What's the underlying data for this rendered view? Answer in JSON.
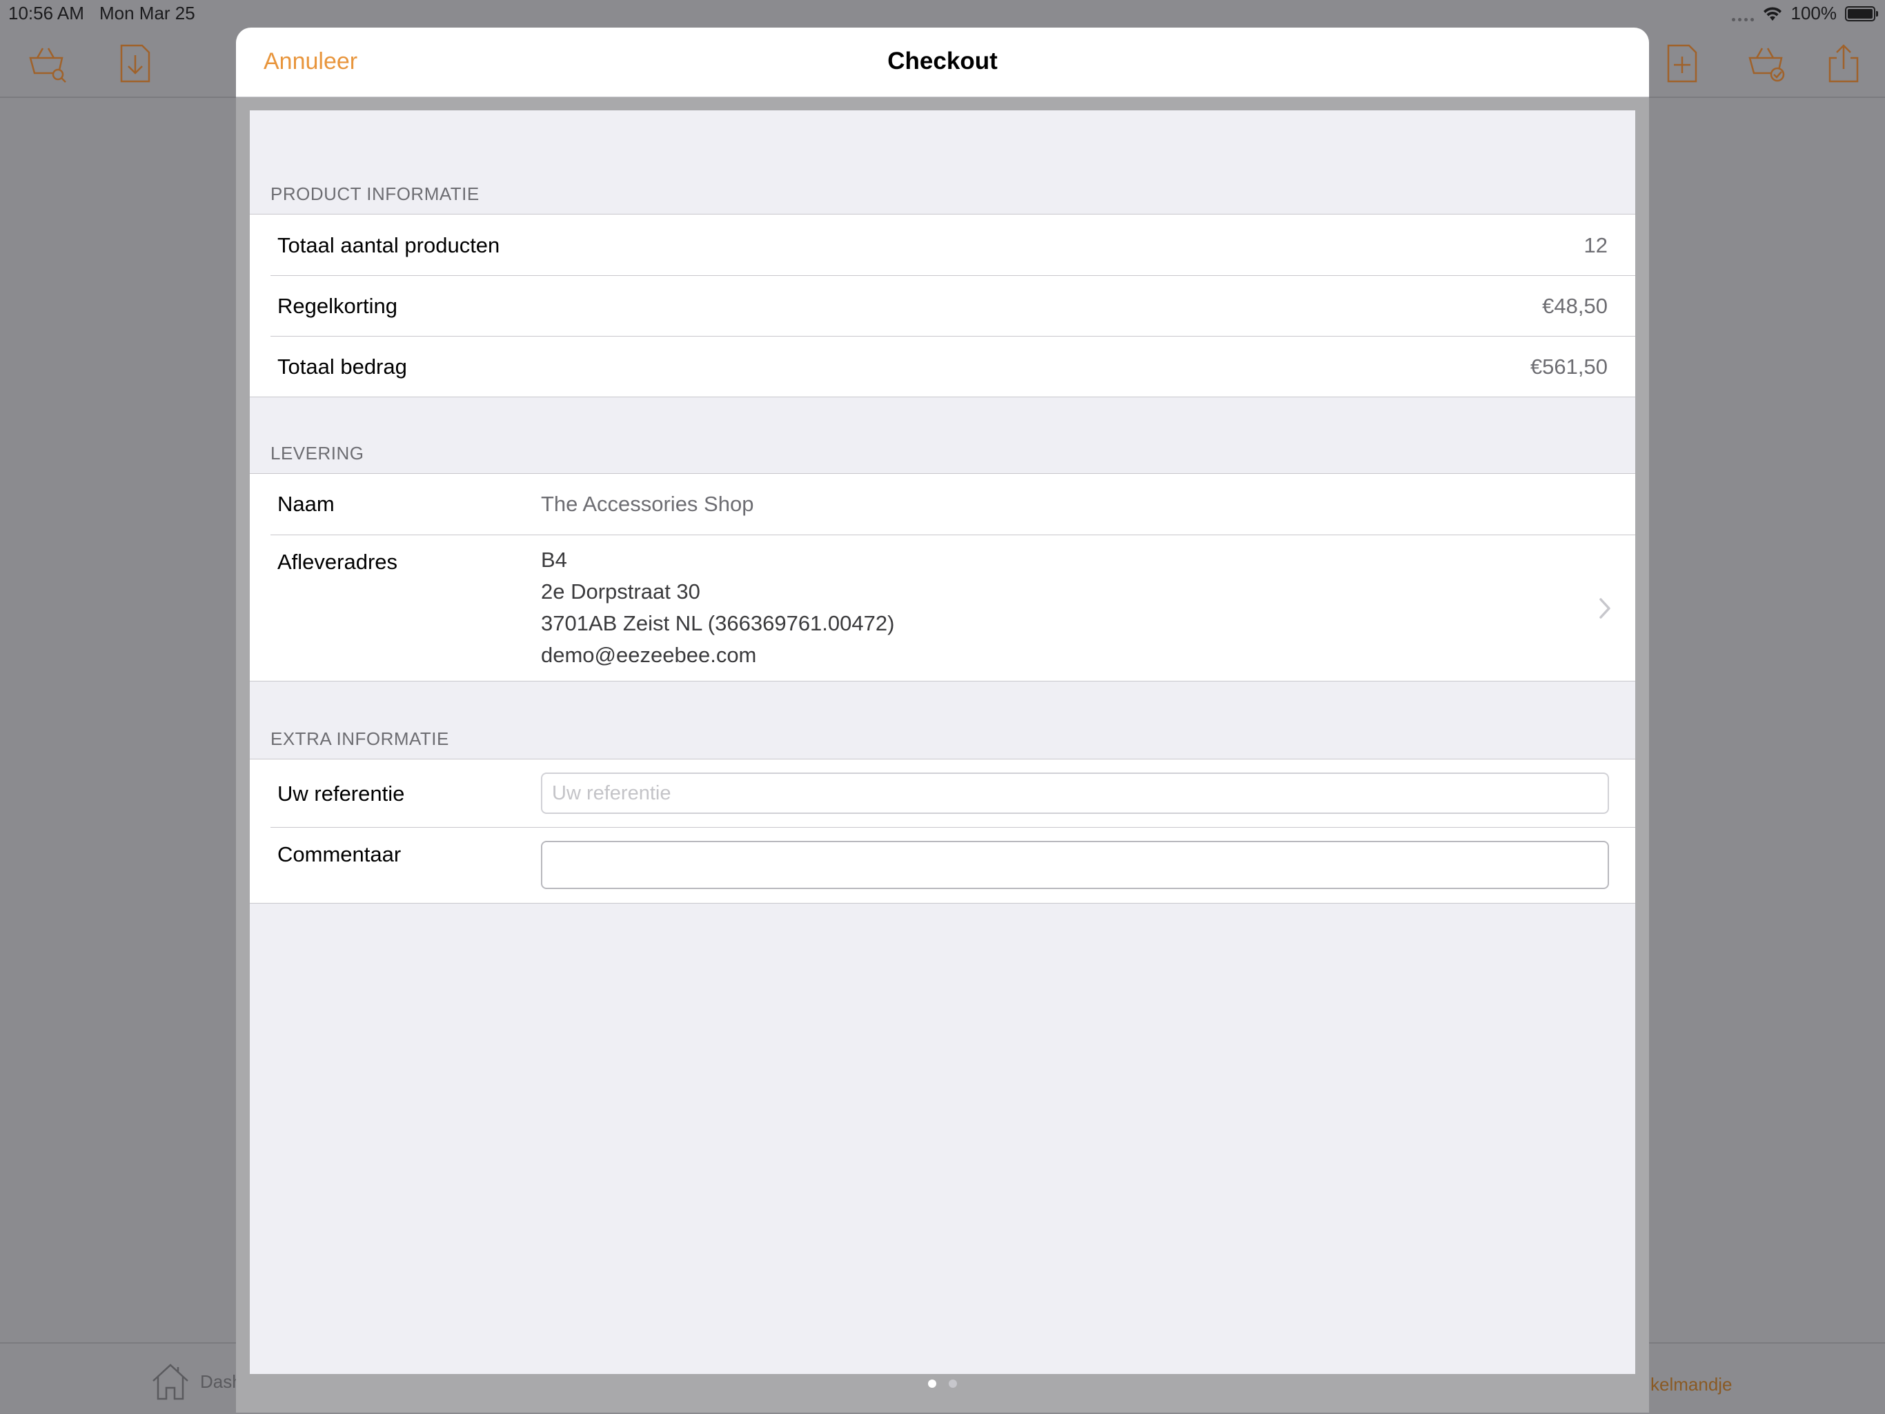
{
  "status_bar": {
    "time": "10:56 AM",
    "date": "Mon Mar 25",
    "battery": "100%"
  },
  "background_app": {
    "toolbar_icons": [
      "basket-search-icon",
      "download-document-icon",
      "new-document-icon",
      "basket-check-icon",
      "share-icon"
    ],
    "tab_home_label": "Dash",
    "tab_cart_label": "kelmandje"
  },
  "modal": {
    "cancel_label": "Annuleer",
    "title": "Checkout"
  },
  "product_section": {
    "header": "PRODUCT INFORMATIE",
    "rows": [
      {
        "label": "Totaal aantal producten",
        "value": "12"
      },
      {
        "label": "Regelkorting",
        "value": "€48,50"
      },
      {
        "label": "Totaal bedrag",
        "value": "€561,50"
      }
    ]
  },
  "delivery_section": {
    "header": "LEVERING",
    "name_label": "Naam",
    "name_value": "The Accessories Shop",
    "address_label": "Afleveradres",
    "address_lines": [
      "B4",
      "2e Dorpstraat 30",
      "3701AB Zeist NL (366369761.00472)",
      "demo@eezeebee.com"
    ]
  },
  "extra_section": {
    "header": "EXTRA INFORMATIE",
    "reference_label": "Uw referentie",
    "reference_placeholder": "Uw referentie",
    "reference_value": "",
    "comment_label": "Commentaar",
    "comment_value": ""
  },
  "page_indicator": {
    "total": 2,
    "current": 1
  },
  "colors": {
    "accent": "#e8953c",
    "toolbar_icon": "#a0622a",
    "dot_active": "#ffffff",
    "dot_inactive": "#c7c7cc"
  }
}
